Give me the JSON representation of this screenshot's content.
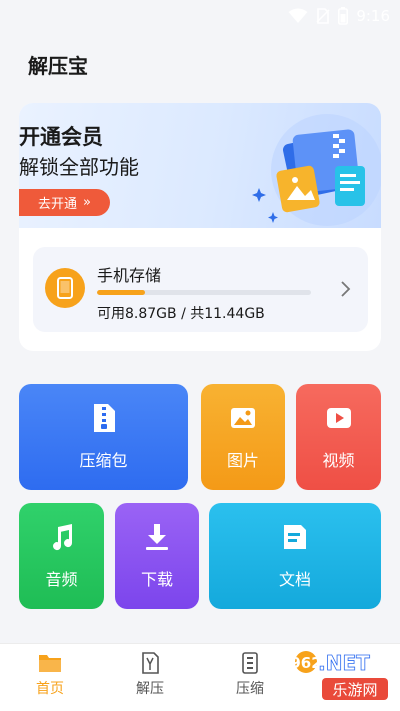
{
  "status_bar": {
    "time": "9:16"
  },
  "app_title": "解压宝",
  "banner": {
    "title": "开通会员",
    "subtitle": "解锁全部功能",
    "button_label": "去开通",
    "button_arrow": "»"
  },
  "storage": {
    "title": "手机存储",
    "usage_text": "可用8.87GB / 共11.44GB",
    "used_fraction": 0.225
  },
  "tiles": [
    {
      "label": "压缩包",
      "icon": "zip-file-icon"
    },
    {
      "label": "图片",
      "icon": "image-icon"
    },
    {
      "label": "视频",
      "icon": "video-icon"
    },
    {
      "label": "音频",
      "icon": "music-note-icon"
    },
    {
      "label": "下载",
      "icon": "download-icon"
    },
    {
      "label": "文档",
      "icon": "document-icon"
    }
  ],
  "nav": [
    {
      "label": "首页",
      "icon": "folder-icon",
      "active": true
    },
    {
      "label": "解压",
      "icon": "unzip-icon",
      "active": false
    },
    {
      "label": "压缩",
      "icon": "compress-icon",
      "active": false
    }
  ],
  "watermark": {
    "number": "962",
    "suffix": ".NET",
    "text": "乐游网"
  },
  "colors": {
    "accent": "#f7a21b",
    "banner_button": "#ef5a3a",
    "zip": "#2e6cf0",
    "image": "#f49a17",
    "video": "#ef4f45",
    "audio": "#1fbd55",
    "download": "#7c45ec",
    "document": "#14a9dc"
  }
}
